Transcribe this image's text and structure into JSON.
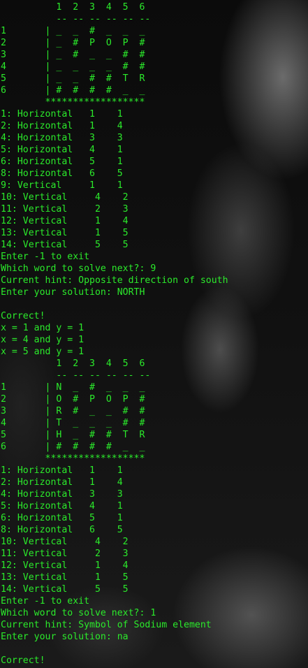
{
  "terminal": {
    "lines": [
      "          1  2  3  4  5  6",
      "          -- -- -- -- -- --",
      "1       | _  _  #  _  _  _",
      "2       | _  #  P  O  P  #",
      "3       | _  #  _  _  #  #",
      "4       | _  _  _  _  #  #",
      "5       | _  _  #  #  T  R",
      "6       | #  #  #  #  _  _",
      "        ******************",
      "1: Horizontal   1    1",
      "2: Horizontal   1    4",
      "4: Horizontal   3    3",
      "5: Horizontal   4    1",
      "6: Horizontal   5    1",
      "8: Horizontal   6    5",
      "9: Vertical     1    1",
      "10: Vertical     4    2",
      "11: Vertical     2    3",
      "12: Vertical     1    4",
      "13: Vertical     1    5",
      "14: Vertical     5    5",
      "Enter -1 to exit",
      "Which word to solve next?: 9",
      "Current hint: Opposite direction of south",
      "Enter your solution: NORTH",
      "",
      "Correct!",
      "x = 1 and y = 1",
      "x = 4 and y = 1",
      "x = 5 and y = 1",
      "          1  2  3  4  5  6",
      "          -- -- -- -- -- --",
      "1       | N  _  #  _  _  _",
      "2       | O  #  P  O  P  #",
      "3       | R  #  _  _  #  #",
      "4       | T  _  _  _  #  #",
      "5       | H  _  #  #  T  R",
      "6       | #  #  #  #  _  _",
      "        ******************",
      "1: Horizontal   1    1",
      "2: Horizontal   1    4",
      "4: Horizontal   3    3",
      "5: Horizontal   4    1",
      "6: Horizontal   5    1",
      "8: Horizontal   6    5",
      "10: Vertical     4    2",
      "11: Vertical     2    3",
      "12: Vertical     1    4",
      "13: Vertical     1    5",
      "14: Vertical     5    5",
      "Enter -1 to exit",
      "Which word to solve next?: 1",
      "Current hint: Symbol of Sodium element",
      "Enter your solution: na",
      "",
      "Correct!"
    ]
  }
}
